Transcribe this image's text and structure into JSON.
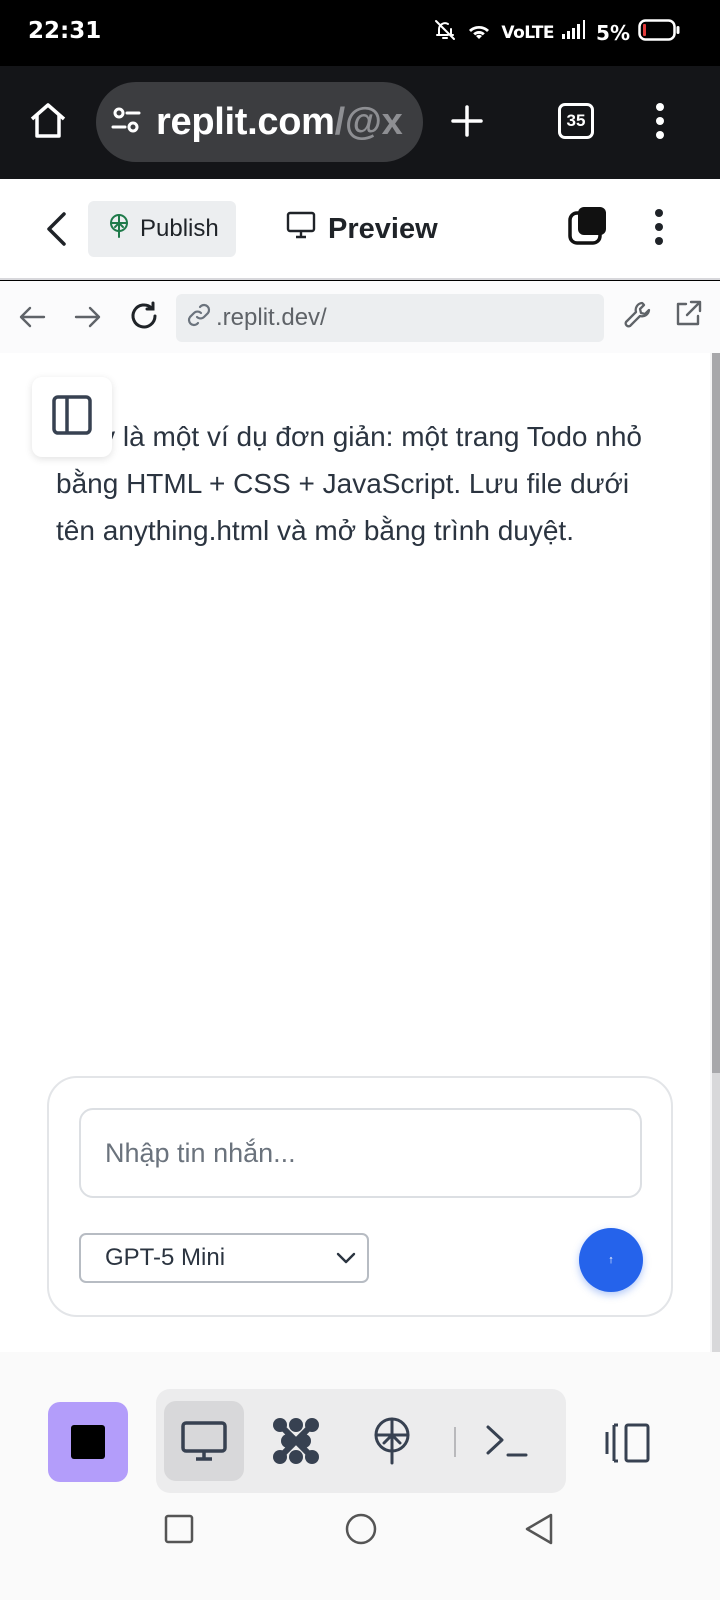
{
  "status_bar": {
    "time": "22:31",
    "network": "VoLTE",
    "battery": "5%"
  },
  "browser": {
    "url_main": "replit.com",
    "url_rest": "/@x",
    "tab_count": "35"
  },
  "header": {
    "publish_label": "Publish",
    "preview_label": "Preview"
  },
  "preview_nav": {
    "url": ".replit.dev/"
  },
  "content": {
    "message": "i đây là một ví dụ đơn giản: một trang Todo nhỏ bằng HTML + CSS + JavaScript. Lưu file dưới tên anything.html và mở bằng trình duyệt."
  },
  "chat": {
    "placeholder": "Nhập tin nhắn...",
    "model": "GPT-5 Mini",
    "send_glyph": "↑"
  },
  "colors": {
    "accent": "#2563eb",
    "stop_button": "#b39dfa"
  },
  "icons": {
    "toolbar": [
      "stop-icon",
      "desktop-icon",
      "network-icon",
      "publish-icon",
      "terminal-icon",
      "layout-icon"
    ],
    "android_nav": [
      "recents-icon",
      "home-icon",
      "back-icon"
    ]
  }
}
